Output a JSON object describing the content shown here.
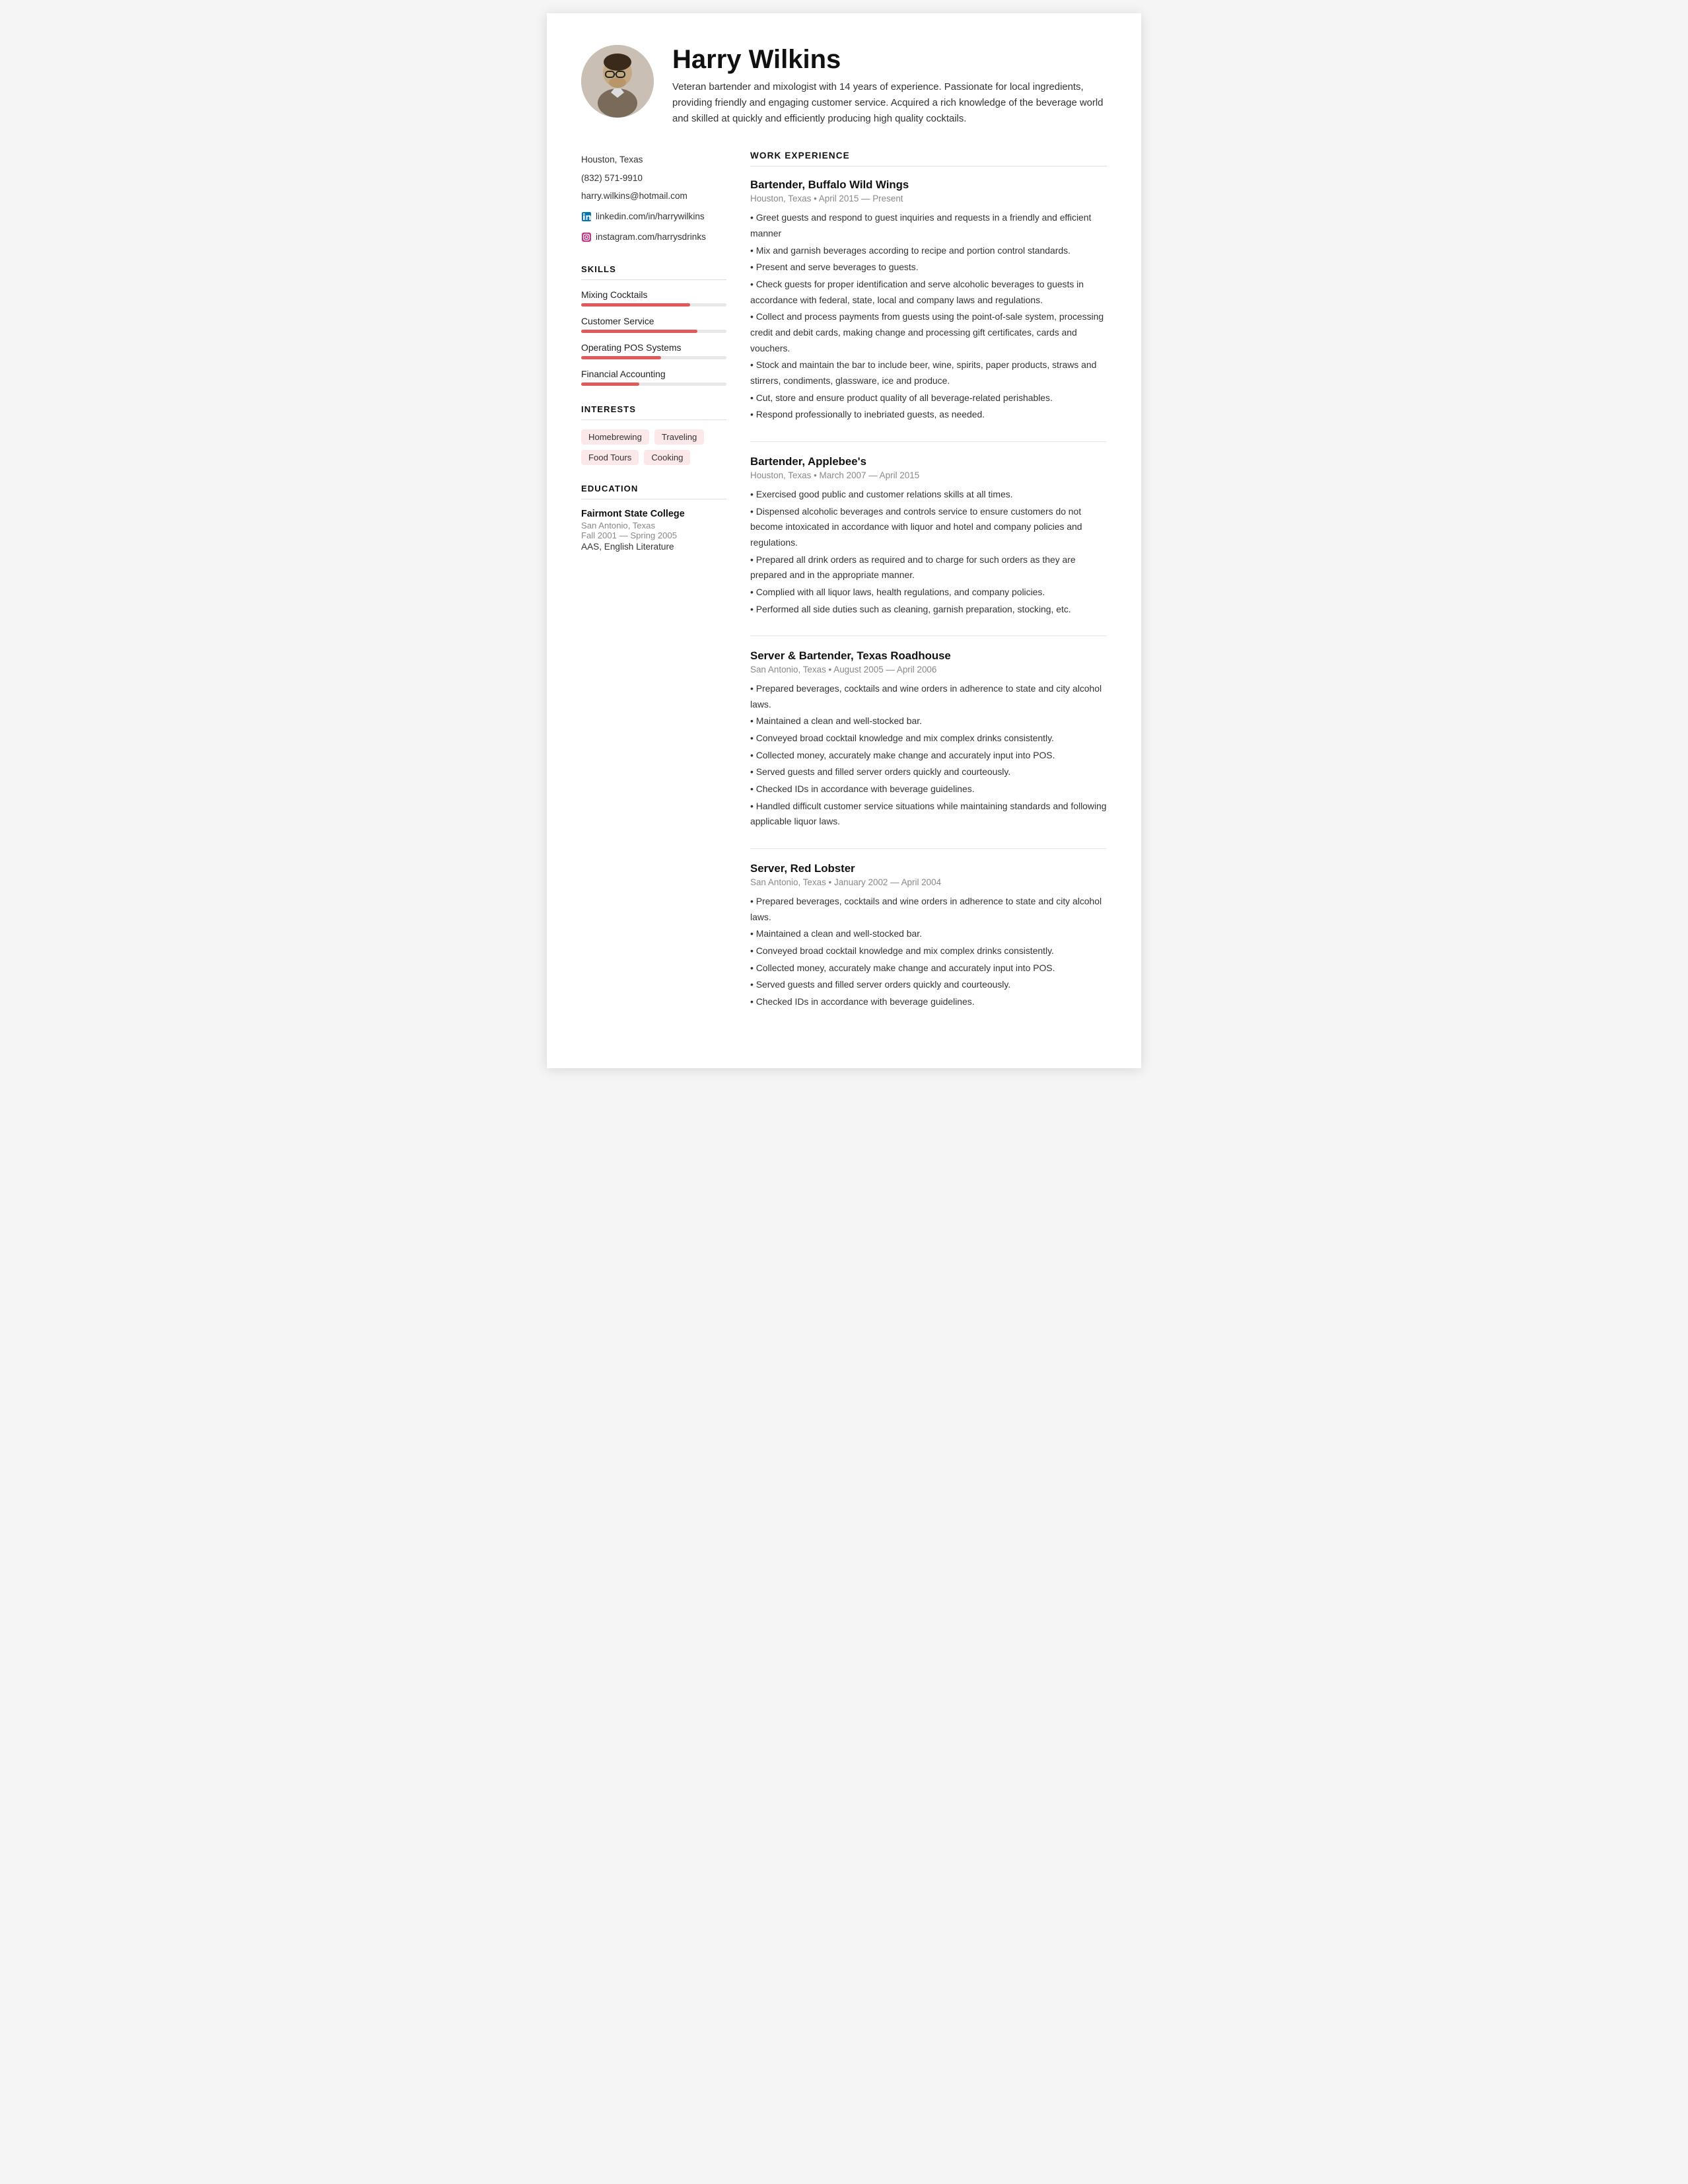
{
  "header": {
    "name": "Harry Wilkins",
    "summary": "Veteran bartender and mixologist with 14 years of experience. Passionate for local ingredients, providing friendly and engaging customer service. Acquired a rich knowledge of the beverage world and skilled at quickly and efficiently producing high quality cocktails."
  },
  "contact": {
    "city": "Houston, Texas",
    "phone": "(832) 571-9910",
    "email": "harry.wilkins@hotmail.com",
    "linkedin": "linkedin.com/in/harrywilkins",
    "instagram": "instagram.com/harrysdrinks"
  },
  "skills": {
    "title": "SKILLS",
    "items": [
      {
        "name": "Mixing Cocktails",
        "pct": 75
      },
      {
        "name": "Customer Service",
        "pct": 80
      },
      {
        "name": "Operating POS Systems",
        "pct": 55
      },
      {
        "name": "Financial Accounting",
        "pct": 40
      }
    ]
  },
  "interests": {
    "title": "INTERESTS",
    "items": [
      "Homebrewing",
      "Traveling",
      "Food Tours",
      "Cooking"
    ]
  },
  "education": {
    "title": "EDUCATION",
    "school": "Fairmont State College",
    "location": "San Antonio, Texas",
    "dates": "Fall 2001 — Spring 2005",
    "degree": "AAS, English Literature"
  },
  "work": {
    "title": "WORK EXPERIENCE",
    "jobs": [
      {
        "title": "Bartender, Buffalo Wild Wings",
        "meta": "Houston, Texas • April 2015 — Present",
        "bullets": [
          "• Greet guests and respond to guest inquiries and requests in a friendly and efficient manner",
          "• Mix and garnish beverages according to recipe and portion control standards.",
          "• Present and serve beverages to guests.",
          "• Check guests for proper identification and serve alcoholic beverages to guests in accordance with federal, state, local and company laws and regulations.",
          "• Collect and process payments from guests using the point-of-sale system, processing credit and debit cards, making change and processing gift certificates, cards and vouchers.",
          "• Stock and maintain the bar to include beer, wine, spirits, paper products, straws and stirrers, condiments, glassware, ice and produce.",
          "• Cut, store and ensure product quality of all beverage-related perishables.",
          "• Respond professionally to inebriated guests, as needed."
        ]
      },
      {
        "title": "Bartender, Applebee's",
        "meta": "Houston, Texas • March 2007 — April 2015",
        "bullets": [
          "• Exercised good public and customer relations skills at all times.",
          "• Dispensed alcoholic beverages and controls service to ensure customers do not become intoxicated in accordance with liquor and hotel and company policies and regulations.",
          "• Prepared all drink orders as required and to charge for such orders as they are prepared and in the appropriate manner.",
          "• Complied with all liquor laws, health regulations, and company policies.",
          "• Performed all side duties such as cleaning, garnish preparation, stocking, etc."
        ]
      },
      {
        "title": "Server & Bartender, Texas Roadhouse",
        "meta": "San Antonio, Texas • August 2005 — April 2006",
        "bullets": [
          "• Prepared beverages, cocktails and wine orders in adherence to state and city alcohol laws.",
          "• Maintained a clean and well-stocked bar.",
          "• Conveyed broad cocktail knowledge and mix complex drinks consistently.",
          "• Collected money, accurately make change and accurately input into POS.",
          "• Served guests and filled server orders quickly and courteously.",
          "• Checked IDs in accordance with beverage guidelines.",
          "• Handled difficult customer service situations while maintaining standards and following applicable liquor laws."
        ]
      },
      {
        "title": "Server, Red Lobster",
        "meta": "San Antonio, Texas • January 2002 — April 2004",
        "bullets": [
          "• Prepared beverages, cocktails and wine orders in adherence to state and city alcohol laws.",
          "• Maintained a clean and well-stocked bar.",
          "• Conveyed broad cocktail knowledge and mix complex drinks consistently.",
          "• Collected money, accurately make change and accurately input into POS.",
          "• Served guests and filled server orders quickly and courteously.",
          "• Checked IDs in accordance with beverage guidelines."
        ]
      }
    ]
  }
}
